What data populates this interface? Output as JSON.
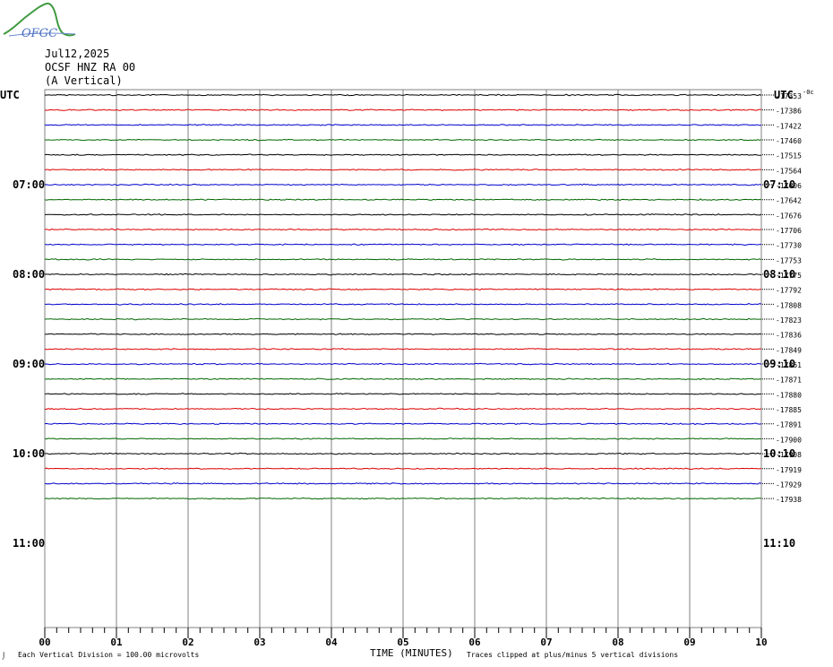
{
  "logo": {
    "text": "OFGC",
    "icon": "ofgc-logo-icon"
  },
  "header": {
    "date": "Jul12,2025",
    "station": "OCSF HNZ RA 00",
    "component": "(A Vertical)"
  },
  "labels": {
    "utc_left": "UTC",
    "utc_right": "UTC",
    "xlabel": "TIME (MINUTES)",
    "scale_note": "Each Vertical Division =  100.00 microvolts",
    "clip_note": "Traces clipped at plus/minus 5 vertical divisions",
    "corner_mark": "⌡",
    "top_right_mark": "-0c"
  },
  "colors": {
    "black": "#000000",
    "red": "#dd0000",
    "blue": "#0000cc",
    "green": "#006600",
    "grid": "#808080"
  },
  "chart_data": {
    "type": "line",
    "title": "OCSF HNZ RA 00 (A Vertical)",
    "xlabel": "TIME (MINUTES)",
    "x_ticks": [
      "00",
      "01",
      "02",
      "03",
      "04",
      "05",
      "06",
      "07",
      "08",
      "09",
      "10"
    ],
    "xlim": [
      0,
      10
    ],
    "left_time_labels": [
      {
        "label": "07:00",
        "row": 6
      },
      {
        "label": "08:00",
        "row": 12
      },
      {
        "label": "09:00",
        "row": 18
      },
      {
        "label": "10:00",
        "row": 24
      },
      {
        "label": "11:00",
        "row": 30
      }
    ],
    "right_time_labels": [
      {
        "label": "07:10",
        "row": 6
      },
      {
        "label": "08:10",
        "row": 12
      },
      {
        "label": "09:10",
        "row": 18
      },
      {
        "label": "10:10",
        "row": 24
      },
      {
        "label": "11:10",
        "row": 30
      }
    ],
    "trace_color_cycle": [
      "black",
      "red",
      "blue",
      "green"
    ],
    "traces": [
      -17353,
      -17386,
      -17422,
      -17460,
      -17515,
      -17564,
      -17606,
      -17642,
      -17676,
      -17706,
      -17730,
      -17753,
      -17775,
      -17792,
      -17808,
      -17823,
      -17836,
      -17849,
      -17861,
      -17871,
      -17880,
      -17885,
      -17891,
      -17900,
      -17908,
      -17919,
      -17929,
      -17938
    ],
    "total_rows": 36,
    "grid": true
  }
}
